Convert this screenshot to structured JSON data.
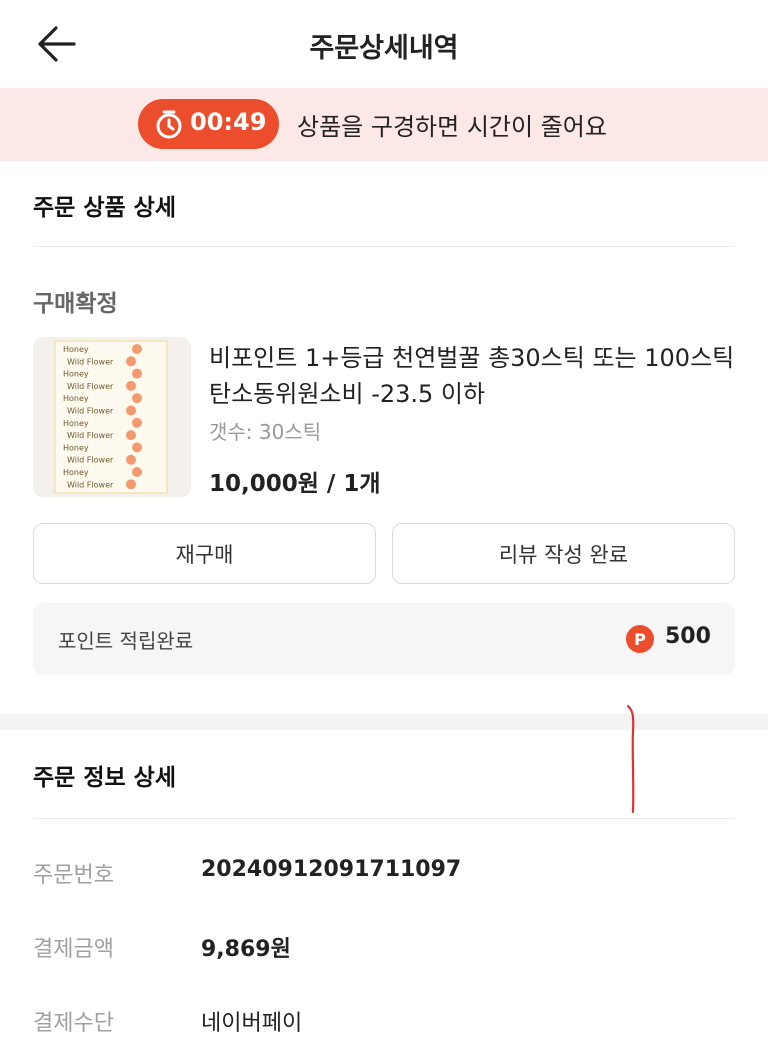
{
  "header": {
    "title": "주문상세내역",
    "back_icon": "arrow-left-icon"
  },
  "timer": {
    "value": "00:49",
    "message": "상품을 구경하면 시간이 줄어요",
    "icon": "stopwatch-icon",
    "accent": "#ec4d2c",
    "banner_bg": "#fce8e6"
  },
  "product_section": {
    "title": "주문 상품 상세",
    "status": "구매확정",
    "product": {
      "name": "비포인트 1+등급 천연벌꿀 총30스틱 또는 100스틱 탄소동위원소비 -23.5 이하",
      "option": "갯수: 30스틱",
      "price": "10,000원 / 1개",
      "thumb_text": [
        "Honey",
        "Wild Flower",
        "Honey",
        "Wild Flower",
        "Honey",
        "Wild Flower",
        "Honey",
        "Wild Flower",
        "Honey",
        "Wild Flower",
        "Honey",
        "Wild Flower"
      ]
    },
    "buttons": {
      "rebuy": "재구매",
      "review": "리뷰 작성 완료"
    },
    "points": {
      "label": "포인트 적립완료",
      "coin": "P",
      "value": "500"
    }
  },
  "order_section": {
    "title": "주문 정보 상세",
    "rows": [
      {
        "label": "주문번호",
        "value": "20240912091711097"
      },
      {
        "label": "결제금액",
        "value": "9,869원"
      },
      {
        "label": "결제수단",
        "value": "네이버페이"
      }
    ]
  }
}
